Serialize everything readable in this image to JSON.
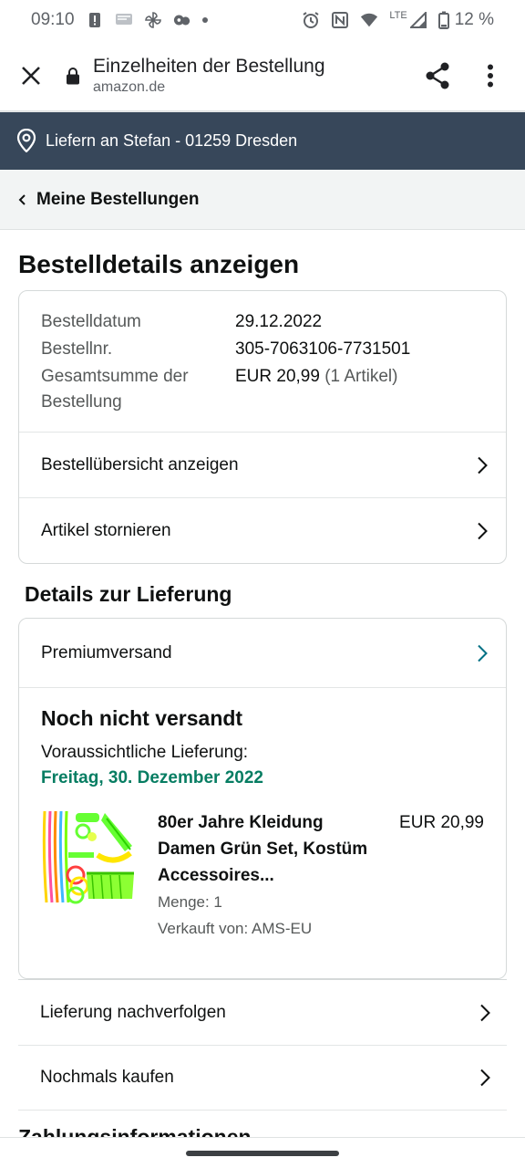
{
  "status_bar": {
    "time": "09:10",
    "lte": "LTE",
    "battery": "12 %"
  },
  "browser": {
    "title": "Einzelheiten der Bestellung",
    "url": "amazon.de"
  },
  "delivery_bar": {
    "text": "Liefern an Stefan - 01259 Dresden"
  },
  "breadcrumb": {
    "label": "Meine Bestellungen"
  },
  "page_title": "Bestelldetails anzeigen",
  "order_info": {
    "date_label": "Bestelldatum",
    "date_value": "29.12.2022",
    "number_label": "Bestellnr.",
    "number_value": "305-7063106-7731501",
    "total_label": "Gesamtsumme der Bestellung",
    "total_value": "EUR 20,99",
    "total_count": "(1 Artikel)"
  },
  "order_actions": [
    {
      "label": "Bestellübersicht anzeigen"
    },
    {
      "label": "Artikel stornieren"
    }
  ],
  "delivery_section": {
    "title": "Details zur Lieferung",
    "shipping_method": "Premiumversand",
    "status": "Noch nicht versandt",
    "eta_label": "Voraussichtliche Lieferung:",
    "eta_date": "Freitag, 30. Dezember 2022",
    "item": {
      "title": "80er Jahre Kleidung Damen Grün Set, Kostüm Accessoires...",
      "quantity": "Menge: 1",
      "seller": "Verkauft von: AMS-EU",
      "price": "EUR 20,99"
    }
  },
  "bottom_actions": [
    {
      "label": "Lieferung nachverfolgen"
    },
    {
      "label": "Nochmals kaufen"
    }
  ],
  "peek_section_title": "Zahlungsinformationen",
  "colors": {
    "delivery_bar_bg": "#37475a",
    "eta_green": "#067d62",
    "teal_chevron": "#007185"
  }
}
